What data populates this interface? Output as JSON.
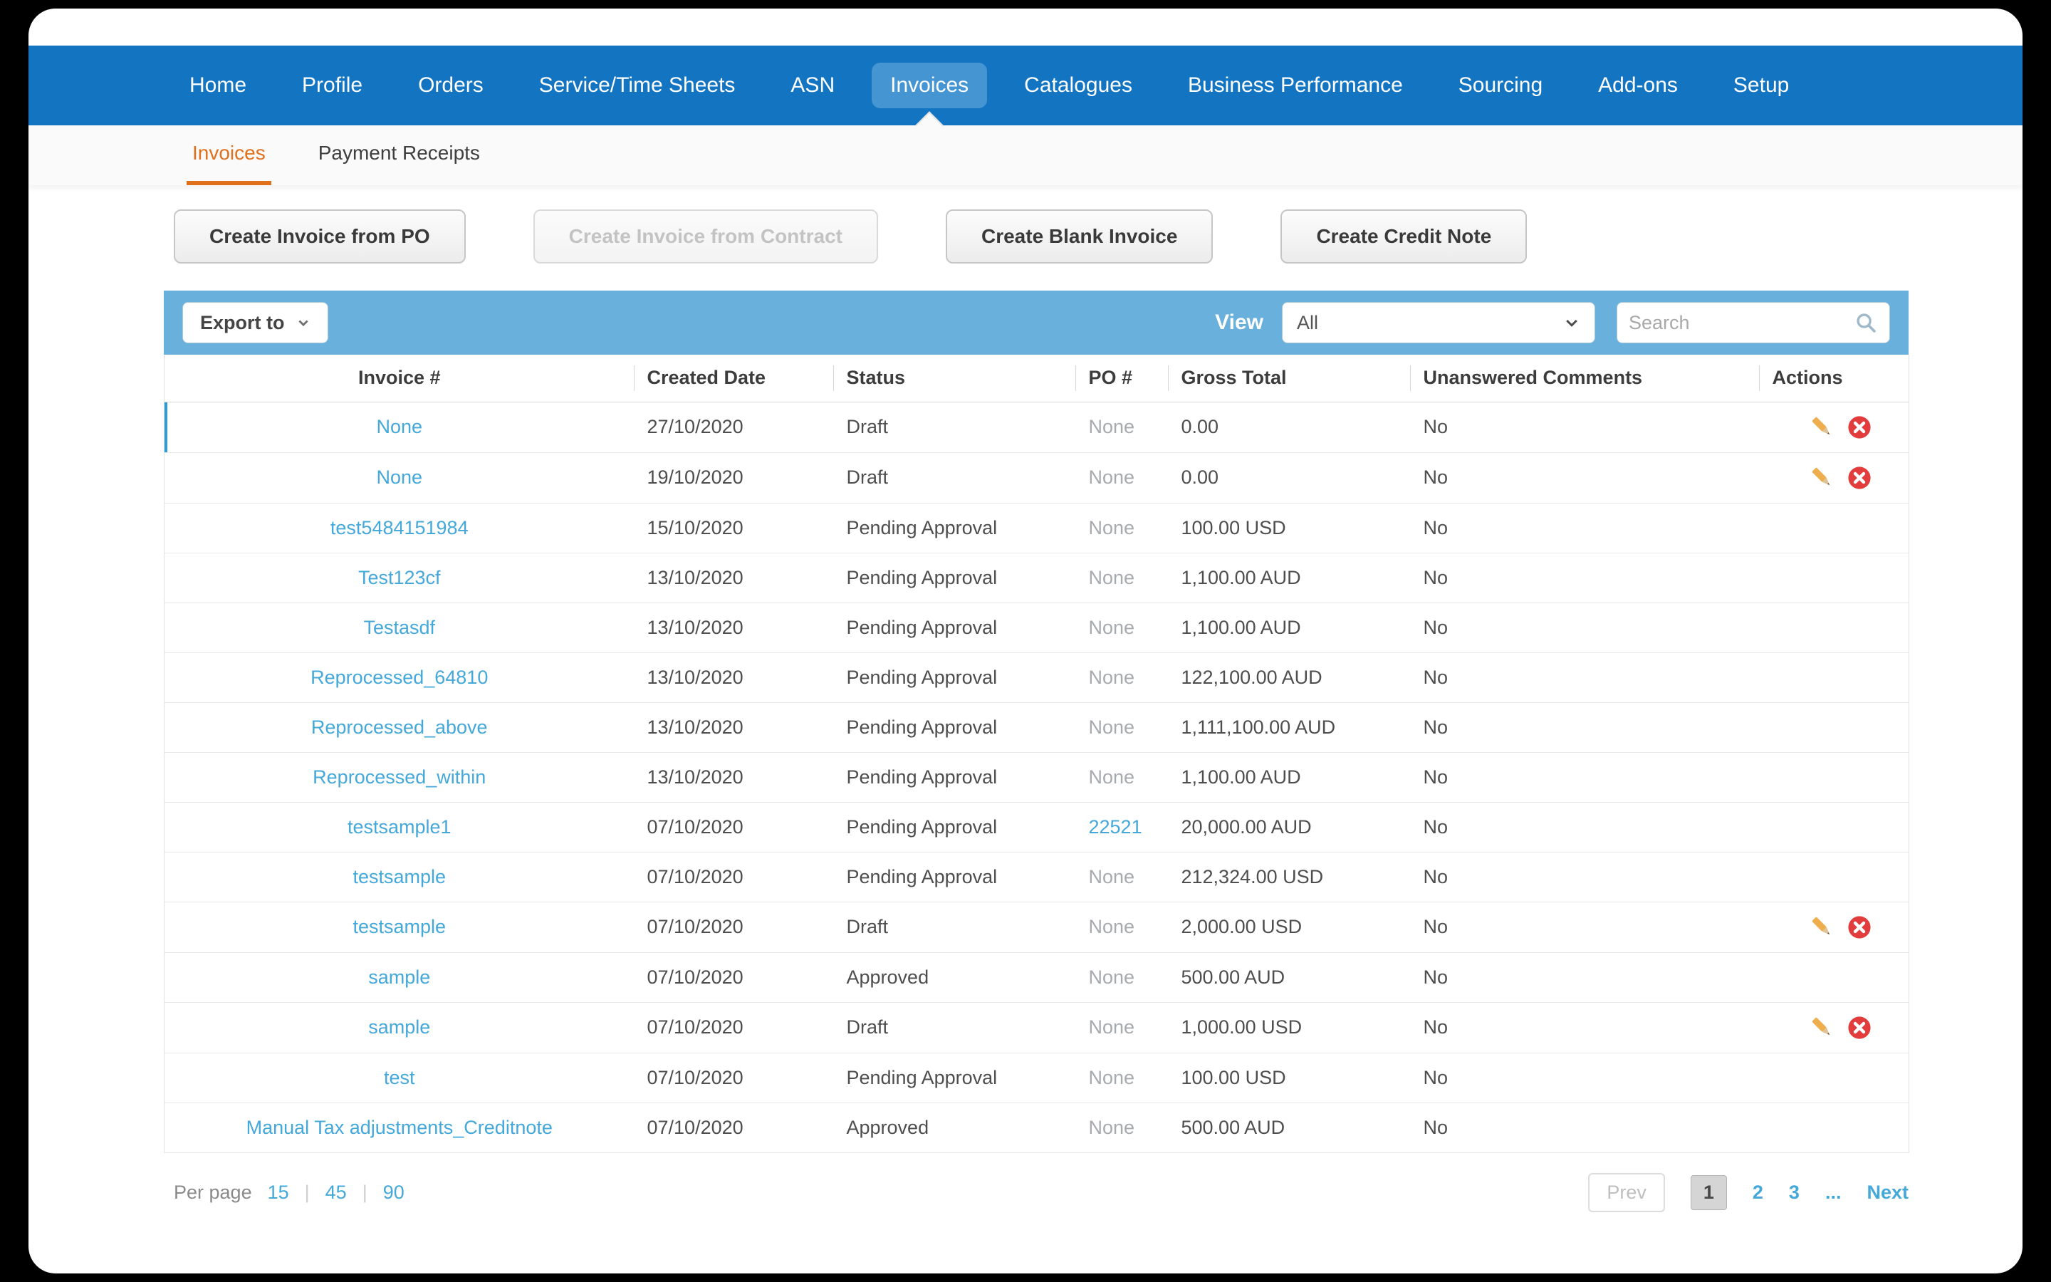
{
  "colors": {
    "nav_blue": "#1374c2",
    "nav_active_pill": "#4595d3",
    "tab_orange": "#e0701c",
    "toolbar_blue": "#69b0dd",
    "link_blue": "#45a8da",
    "selected_row_accent": "#2b9cd8",
    "delete_red": "#e23c3c",
    "pencil_orange": "#eeae4e"
  },
  "icons": {
    "export_caret": "chevron-down",
    "view_select_caret": "chevron-down",
    "search": "magnifier",
    "edit": "pencil",
    "delete": "red-circle-x"
  },
  "nav": {
    "items": [
      {
        "label": "Home",
        "active": false
      },
      {
        "label": "Profile",
        "active": false
      },
      {
        "label": "Orders",
        "active": false
      },
      {
        "label": "Service/Time Sheets",
        "active": false
      },
      {
        "label": "ASN",
        "active": false
      },
      {
        "label": "Invoices",
        "active": true
      },
      {
        "label": "Catalogues",
        "active": false
      },
      {
        "label": "Business Performance",
        "active": false
      },
      {
        "label": "Sourcing",
        "active": false
      },
      {
        "label": "Add-ons",
        "active": false
      },
      {
        "label": "Setup",
        "active": false
      }
    ]
  },
  "subnav": {
    "items": [
      {
        "label": "Invoices",
        "active": true
      },
      {
        "label": "Payment Receipts",
        "active": false
      }
    ]
  },
  "action_buttons": [
    {
      "label": "Create Invoice from PO",
      "disabled": false
    },
    {
      "label": "Create Invoice from Contract",
      "disabled": true
    },
    {
      "label": "Create Blank Invoice",
      "disabled": false
    },
    {
      "label": "Create Credit Note",
      "disabled": false
    }
  ],
  "toolbar": {
    "export_label": "Export to",
    "view_label": "View",
    "view_selected": "All",
    "search_placeholder": "Search"
  },
  "table": {
    "columns": [
      "Invoice #",
      "Created Date",
      "Status",
      "PO #",
      "Gross Total",
      "Unanswered Comments",
      "Actions"
    ],
    "rows": [
      {
        "invoice": "None",
        "created": "27/10/2020",
        "status": "Draft",
        "po": "None",
        "po_link": false,
        "gross": "0.00",
        "comments": "No",
        "has_actions": true,
        "selected": true
      },
      {
        "invoice": "None",
        "created": "19/10/2020",
        "status": "Draft",
        "po": "None",
        "po_link": false,
        "gross": "0.00",
        "comments": "No",
        "has_actions": true,
        "selected": false
      },
      {
        "invoice": "test5484151984",
        "created": "15/10/2020",
        "status": "Pending Approval",
        "po": "None",
        "po_link": false,
        "gross": "100.00 USD",
        "comments": "No",
        "has_actions": false,
        "selected": false
      },
      {
        "invoice": "Test123cf",
        "created": "13/10/2020",
        "status": "Pending Approval",
        "po": "None",
        "po_link": false,
        "gross": "1,100.00 AUD",
        "comments": "No",
        "has_actions": false,
        "selected": false
      },
      {
        "invoice": "Testasdf",
        "created": "13/10/2020",
        "status": "Pending Approval",
        "po": "None",
        "po_link": false,
        "gross": "1,100.00 AUD",
        "comments": "No",
        "has_actions": false,
        "selected": false
      },
      {
        "invoice": "Reprocessed_64810",
        "created": "13/10/2020",
        "status": "Pending Approval",
        "po": "None",
        "po_link": false,
        "gross": "122,100.00 AUD",
        "comments": "No",
        "has_actions": false,
        "selected": false
      },
      {
        "invoice": "Reprocessed_above",
        "created": "13/10/2020",
        "status": "Pending Approval",
        "po": "None",
        "po_link": false,
        "gross": "1,111,100.00 AUD",
        "comments": "No",
        "has_actions": false,
        "selected": false
      },
      {
        "invoice": "Reprocessed_within",
        "created": "13/10/2020",
        "status": "Pending Approval",
        "po": "None",
        "po_link": false,
        "gross": "1,100.00 AUD",
        "comments": "No",
        "has_actions": false,
        "selected": false
      },
      {
        "invoice": "testsample1",
        "created": "07/10/2020",
        "status": "Pending Approval",
        "po": "22521",
        "po_link": true,
        "gross": "20,000.00 AUD",
        "comments": "No",
        "has_actions": false,
        "selected": false
      },
      {
        "invoice": "testsample",
        "created": "07/10/2020",
        "status": "Pending Approval",
        "po": "None",
        "po_link": false,
        "gross": "212,324.00 USD",
        "comments": "No",
        "has_actions": false,
        "selected": false
      },
      {
        "invoice": "testsample",
        "created": "07/10/2020",
        "status": "Draft",
        "po": "None",
        "po_link": false,
        "gross": "2,000.00 USD",
        "comments": "No",
        "has_actions": true,
        "selected": false
      },
      {
        "invoice": "sample",
        "created": "07/10/2020",
        "status": "Approved",
        "po": "None",
        "po_link": false,
        "gross": "500.00 AUD",
        "comments": "No",
        "has_actions": false,
        "selected": false
      },
      {
        "invoice": "sample",
        "created": "07/10/2020",
        "status": "Draft",
        "po": "None",
        "po_link": false,
        "gross": "1,000.00 USD",
        "comments": "No",
        "has_actions": true,
        "selected": false
      },
      {
        "invoice": "test",
        "created": "07/10/2020",
        "status": "Pending Approval",
        "po": "None",
        "po_link": false,
        "gross": "100.00 USD",
        "comments": "No",
        "has_actions": false,
        "selected": false
      },
      {
        "invoice": "Manual Tax adjustments_Creditnote",
        "created": "07/10/2020",
        "status": "Approved",
        "po": "None",
        "po_link": false,
        "gross": "500.00 AUD",
        "comments": "No",
        "has_actions": false,
        "selected": false
      }
    ]
  },
  "pagination": {
    "per_page_label": "Per page",
    "per_page_options": [
      "15",
      "45",
      "90"
    ],
    "prev_label": "Prev",
    "pages": [
      "1",
      "2",
      "3",
      "..."
    ],
    "current_page": "1",
    "next_label": "Next"
  }
}
